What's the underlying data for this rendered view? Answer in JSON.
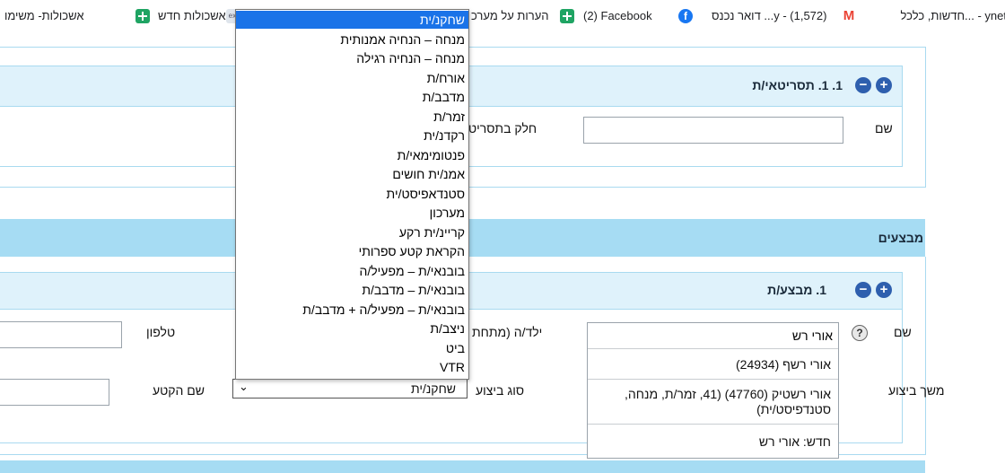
{
  "bookmarks": [
    {
      "label": "חדשות, כלכל... - ynet",
      "icon": "ynet-icon"
    },
    {
      "label": "דואר נכנס ...y - (1,572)",
      "icon": "gmail-icon"
    },
    {
      "label": "(2) Facebook",
      "icon": "facebook-icon"
    },
    {
      "label": "הערות על מערכ",
      "icon": "sheets-icon"
    },
    {
      "label": "אשכולות חדש",
      "icon": "extension-icon"
    },
    {
      "label": "אשכולות- משימו",
      "icon": "sheets-icon"
    }
  ],
  "section1": {
    "title": "1. 1. תסריטאי/ת",
    "name_label": "שם",
    "part_label": "חלק בתסריט",
    "name_value": ""
  },
  "performers": {
    "header": "מבצעים",
    "sub_title": "1. מבצע/ת",
    "name_label": "שם",
    "child_label": "ילד/ה (מתחת",
    "phone_label": "טלפון",
    "duration_label": "משך ביצוע",
    "type_label": "סוג ביצוע",
    "piece_name_label": "שם הקטע",
    "name_input_value": "אורי רש"
  },
  "autocomplete": [
    "אורי רשף (24934)",
    "אורי רשטיק (47760) (41, זמר/ת, מנחה, סטנדפיסט/ית)",
    "חדש: אורי רש"
  ],
  "select": {
    "value": "שחקנ/ית",
    "options": [
      "שחקנ/ית",
      "מנחה – הנחיה אמנותית",
      "מנחה – הנחיה רגילה",
      "אורח/ת",
      "מדבב/ת",
      "זמר/ת",
      "רקדנ/ית",
      "פנטומימאי/ת",
      "אמנ/ית חושים",
      "סטנדאפיסט/ית",
      "מערכון",
      "קריינ/ית רקע",
      "הקראת קטע ספרותי",
      "בובנאי/ת – מפעיל/ה",
      "בובנאי/ת – מדבב/ת",
      "בובנאי/ת – מפעיל/ה + מדבב/ת",
      "ניצב/ת",
      "ביט",
      "VTR"
    ]
  },
  "colors": {
    "accent": "#2e5fae",
    "header_bar": "#a6dcf3",
    "selected_option": "#1a73e8"
  }
}
